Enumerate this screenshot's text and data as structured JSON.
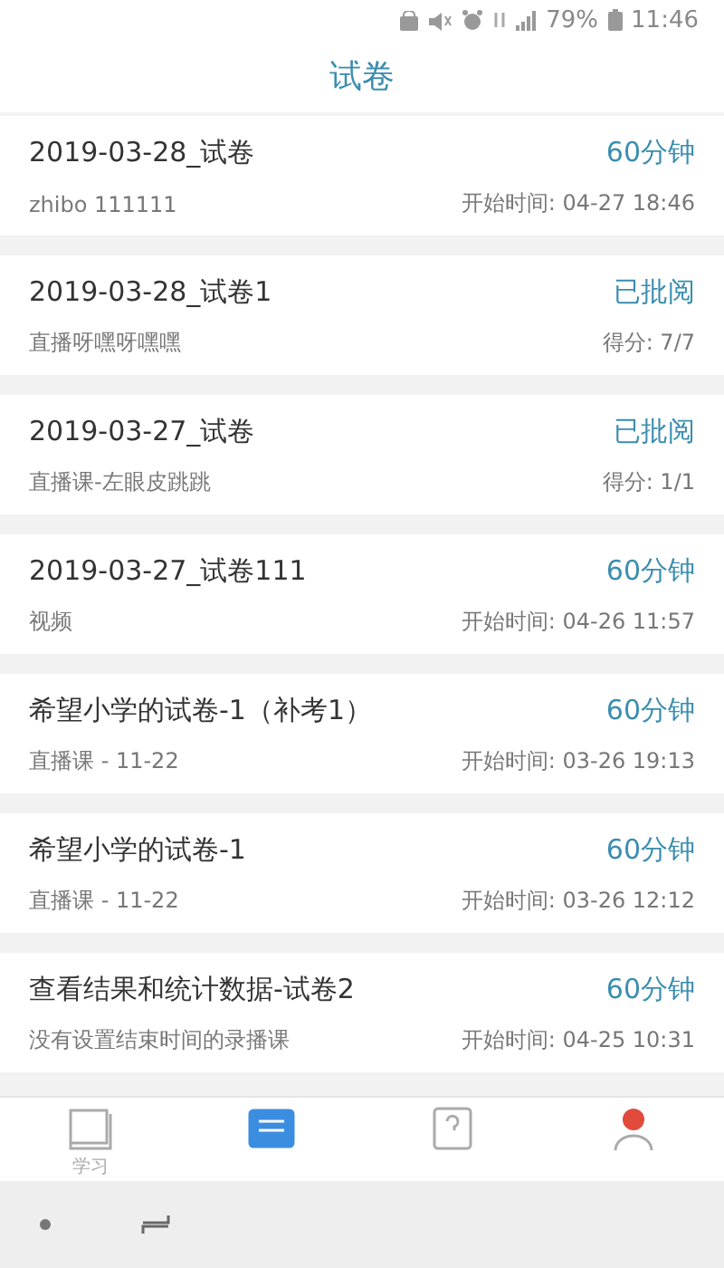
{
  "status_bar": {
    "battery": "79%",
    "time": "11:46"
  },
  "header": {
    "title": "试卷"
  },
  "papers": [
    {
      "title": "2019-03-28_试卷",
      "status": "60分钟",
      "subtitle": "zhibo 111111",
      "info": "开始时间: 04-27 18:46"
    },
    {
      "title": "2019-03-28_试卷1",
      "status": "已批阅",
      "subtitle": "直播呀嘿呀嘿嘿",
      "info": "得分: 7/7"
    },
    {
      "title": "2019-03-27_试卷",
      "status": "已批阅",
      "subtitle": "直播课-左眼皮跳跳",
      "info": "得分: 1/1"
    },
    {
      "title": "2019-03-27_试卷111",
      "status": "60分钟",
      "subtitle": "视频",
      "info": "开始时间: 04-26 11:57"
    },
    {
      "title": "希望小学的试卷-1（补考1）",
      "status": "60分钟",
      "subtitle": "直播课 - 11-22",
      "info": "开始时间: 03-26 19:13"
    },
    {
      "title": "希望小学的试卷-1",
      "status": "60分钟",
      "subtitle": "直播课 - 11-22",
      "info": "开始时间: 03-26 12:12"
    },
    {
      "title": "查看结果和统计数据-试卷2",
      "status": "60分钟",
      "subtitle": "没有设置结束时间的录播课",
      "info": "开始时间: 04-25 10:31"
    }
  ],
  "bottom_nav": [
    {
      "label": "学习",
      "selected": false
    },
    {
      "selected": true
    },
    {
      "selected": false
    },
    {
      "selected": false
    }
  ]
}
